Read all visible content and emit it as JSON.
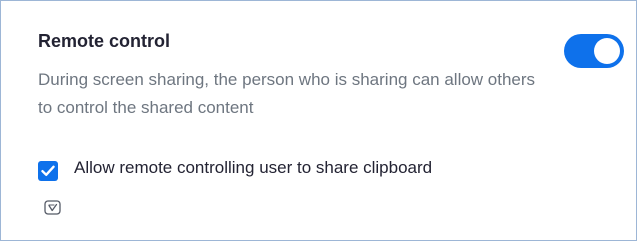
{
  "setting": {
    "title": "Remote control",
    "description": "During screen sharing, the person who is sharing can allow others to control the shared content",
    "toggle_on": true
  },
  "option": {
    "label": "Allow remote controlling user to share clipboard",
    "checked": true
  },
  "icons": {
    "toggle": "toggle-switch-on",
    "checkbox": "checkmark-icon",
    "extra": "locked-setting-icon"
  },
  "colors": {
    "accent": "#0e71eb",
    "title_text": "#232333",
    "description_text": "#6e7680",
    "border": "#9db6d6"
  }
}
